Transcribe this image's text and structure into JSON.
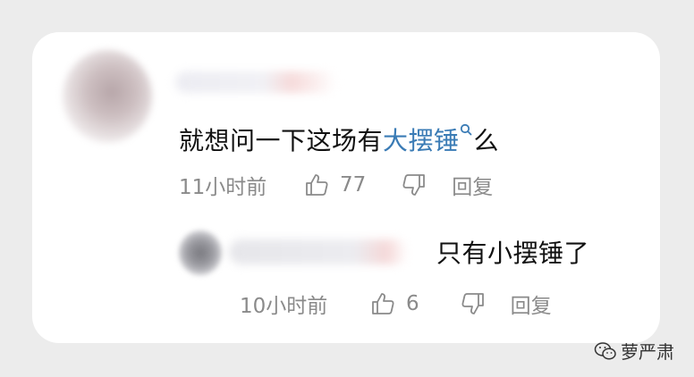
{
  "comment": {
    "text_before": "就想问一下这场有",
    "link_text": "大摆锤",
    "text_after": "么",
    "time": "11小时前",
    "like_count": "77",
    "reply_label": "回复"
  },
  "reply": {
    "text": "只有小摆锤了",
    "time": "10小时前",
    "like_count": "6",
    "reply_label": "回复"
  },
  "watermark": {
    "text": "萝严肃"
  },
  "colors": {
    "link": "#3a7bb5",
    "meta": "#8a8a8a",
    "card": "#ffffff",
    "background": "#ececec"
  },
  "icons": [
    "thumbs-up-icon",
    "thumbs-down-icon",
    "search-icon",
    "wechat-icon"
  ]
}
